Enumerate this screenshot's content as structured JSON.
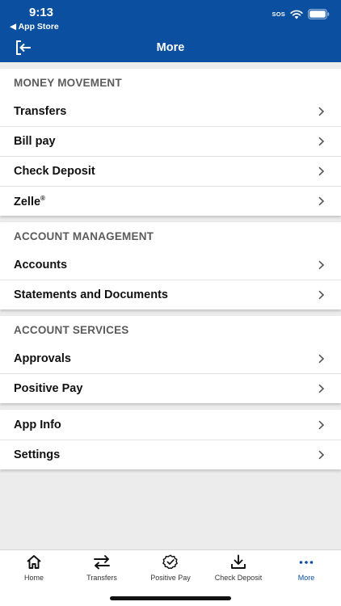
{
  "status_bar": {
    "time": "9:13",
    "back_label": "◀ App Store",
    "sos_label": "SOS"
  },
  "header": {
    "title": "More"
  },
  "sections": [
    {
      "title": "MONEY MOVEMENT",
      "items": [
        {
          "label": "Transfers"
        },
        {
          "label": "Bill pay"
        },
        {
          "label": "Check Deposit"
        },
        {
          "label": "Zelle",
          "sup": "®"
        }
      ]
    },
    {
      "title": "ACCOUNT MANAGEMENT",
      "items": [
        {
          "label": "Accounts"
        },
        {
          "label": "Statements and Documents"
        }
      ]
    },
    {
      "title": "ACCOUNT SERVICES",
      "items": [
        {
          "label": "Approvals"
        },
        {
          "label": "Positive Pay"
        }
      ]
    },
    {
      "title": "",
      "items": [
        {
          "label": "App Info"
        },
        {
          "label": "Settings"
        }
      ]
    }
  ],
  "tabbar": {
    "tabs": [
      {
        "label": "Home",
        "icon": "home-icon",
        "active": false
      },
      {
        "label": "Transfers",
        "icon": "transfer-arrows-icon",
        "active": false
      },
      {
        "label": "Positive Pay",
        "icon": "badge-check-icon",
        "active": false
      },
      {
        "label": "Check Deposit",
        "icon": "download-tray-icon",
        "active": false
      },
      {
        "label": "More",
        "icon": "more-dots-icon",
        "active": true
      }
    ]
  },
  "colors": {
    "brand": "#0a4fa0",
    "background": "#ececec",
    "section_header_text": "#5b5b5b"
  }
}
